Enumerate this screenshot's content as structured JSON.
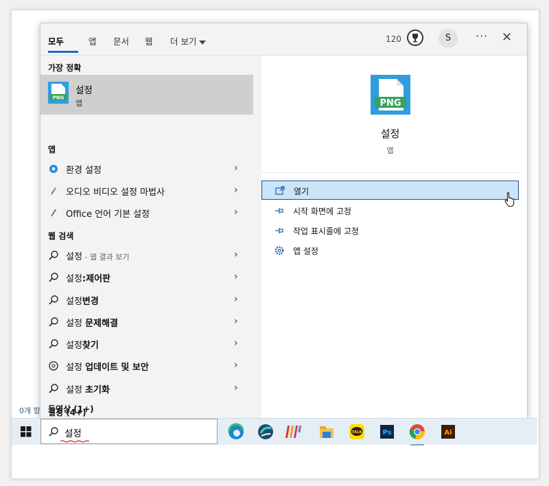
{
  "desktop": {
    "hint_text": "0개 항"
  },
  "topbar": {
    "tabs": [
      "모두",
      "앱",
      "문서",
      "웹",
      "더 보기"
    ],
    "active_tab": "모두",
    "reward_count": "120",
    "avatar_letter": "S",
    "more_label": "···",
    "close_label": "✕"
  },
  "left": {
    "best_match_heading": "가장 정확",
    "best_match": {
      "title": "설정",
      "subtitle": "앱",
      "icon": "png-file-icon"
    },
    "apps_heading": "앱",
    "apps": [
      {
        "label": "환경 설정",
        "icon": "gear-icon"
      },
      {
        "label": "오디오 비디오 설정 마법사",
        "icon": "wand-icon"
      },
      {
        "label": "Office 언어 기본 설정",
        "icon": "wand-icon"
      }
    ],
    "web_heading": "웹 검색",
    "web": [
      {
        "plain": "설정",
        "bold": "",
        "hint": " - 웹 결과 보기",
        "icon": "search-icon"
      },
      {
        "plain": "설정",
        "bold": ":제어판",
        "hint": "",
        "icon": "search-icon"
      },
      {
        "plain": "설정",
        "bold": "변경",
        "hint": "",
        "icon": "search-icon"
      },
      {
        "plain": "설정 ",
        "bold": "문제해결",
        "hint": "",
        "icon": "search-icon"
      },
      {
        "plain": "설정",
        "bold": "찾기",
        "hint": "",
        "icon": "search-icon"
      },
      {
        "plain": "설정 ",
        "bold": "업데이트 및 보안",
        "hint": "",
        "icon": "web-search-icon"
      },
      {
        "plain": "설정 ",
        "bold": "초기화",
        "hint": "",
        "icon": "search-icon"
      }
    ],
    "settings_group": "설정 (4+)",
    "videos_group": "동영상 (1+)"
  },
  "right": {
    "title": "설정",
    "subtitle": "앱",
    "icon_label": "PNG",
    "actions": [
      {
        "label": "열기",
        "icon": "open-icon",
        "selected": true
      },
      {
        "label": "시작 화면에 고정",
        "icon": "pin-icon",
        "selected": false
      },
      {
        "label": "작업 표시줄에 고정",
        "icon": "pin-icon",
        "selected": false
      },
      {
        "label": "앱 설정",
        "icon": "gear-icon",
        "selected": false
      }
    ]
  },
  "taskbar": {
    "search_text": "설정",
    "apps": [
      "edge-icon",
      "sync-app-icon",
      "colorful-app-icon",
      "file-explorer-icon",
      "kakaotalk-icon",
      "photoshop-icon",
      "chrome-icon",
      "illustrator-icon"
    ],
    "kakao_label": "TALK",
    "ps_label": "Ps",
    "ai_label": "Ai"
  },
  "colors": {
    "accent": "#1b6bc5",
    "selection": "#cce4f7",
    "png_icon": "#2f9de0"
  }
}
